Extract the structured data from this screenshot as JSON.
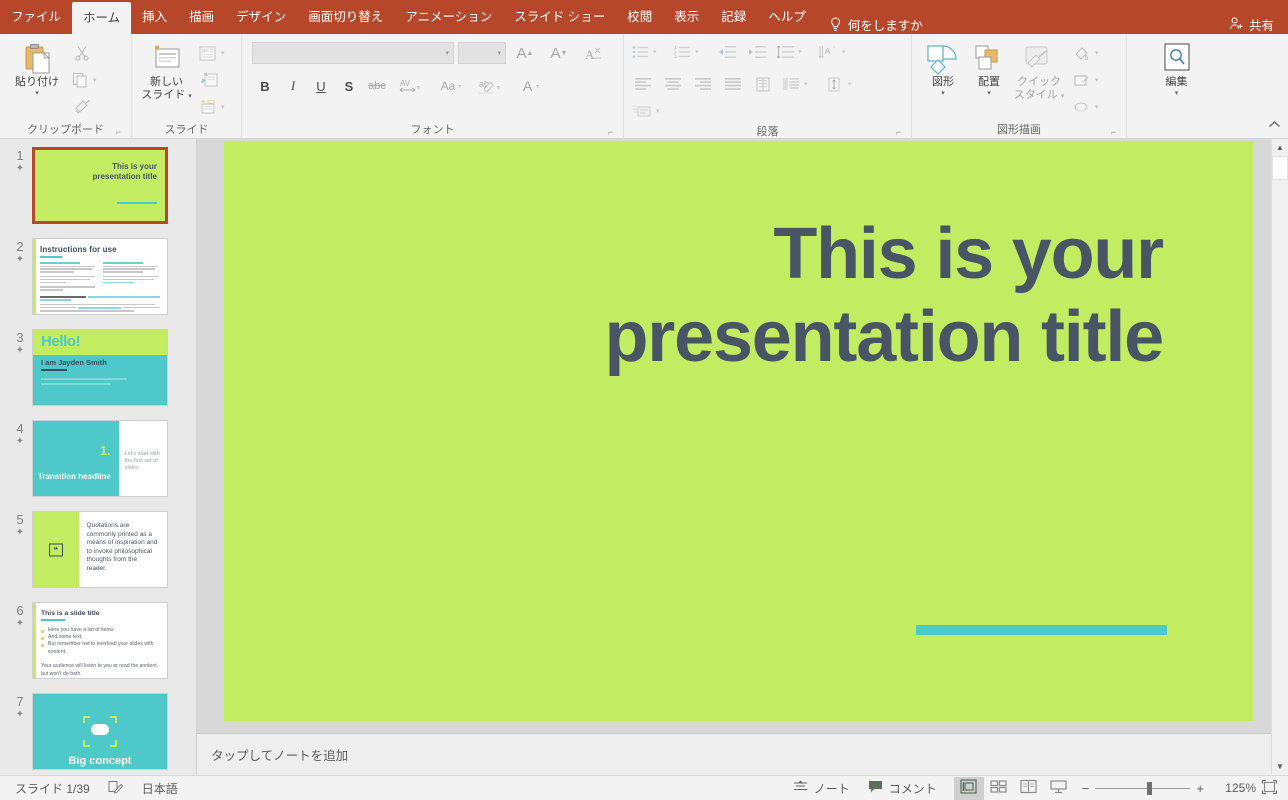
{
  "app": {
    "accent_color": "#b7472a",
    "ribbon_bg": "#f3f3f3"
  },
  "tabs": [
    {
      "id": "file",
      "label": "ファイル",
      "active": false
    },
    {
      "id": "home",
      "label": "ホーム",
      "active": true
    },
    {
      "id": "insert",
      "label": "挿入",
      "active": false
    },
    {
      "id": "draw",
      "label": "描画",
      "active": false
    },
    {
      "id": "design",
      "label": "デザイン",
      "active": false
    },
    {
      "id": "transitions",
      "label": "画面切り替え",
      "active": false
    },
    {
      "id": "animations",
      "label": "アニメーション",
      "active": false
    },
    {
      "id": "slideshow",
      "label": "スライド ショー",
      "active": false
    },
    {
      "id": "review",
      "label": "校閲",
      "active": false
    },
    {
      "id": "view",
      "label": "表示",
      "active": false
    },
    {
      "id": "record",
      "label": "記録",
      "active": false
    },
    {
      "id": "help",
      "label": "ヘルプ",
      "active": false
    }
  ],
  "tellme": {
    "label": "何をしますか",
    "icon": "lightbulb-icon"
  },
  "share": {
    "label": "共有",
    "icon": "share-person-icon"
  },
  "ribbon": {
    "clipboard": {
      "group_label": "クリップボード",
      "paste_label": "貼り付け",
      "cut_label": "切り取り",
      "copy_label": "コピー",
      "format_painter_label": "書式のコピー/貼り付け"
    },
    "slides": {
      "group_label": "スライド",
      "new_slide_label": "新しい\nスライド",
      "new_slide_line1": "新しい",
      "new_slide_line2": "スライド",
      "layout_label": "レイアウト",
      "reset_label": "リセット",
      "section_label": "セクション"
    },
    "font": {
      "group_label": "フォント",
      "font_name_value": "",
      "font_size_value": "",
      "grow_font_label": "A",
      "shrink_font_label": "A",
      "clear_format_label": "すべての書式をクリア",
      "bold_label": "B",
      "italic_label": "I",
      "underline_label": "U",
      "shadow_label": "S",
      "strike_label": "abc",
      "spacing_label": "AV",
      "case_label": "Aa",
      "highlight_label": "ab",
      "color_label": "A"
    },
    "paragraph": {
      "group_label": "段落"
    },
    "drawing": {
      "group_label": "図形描画",
      "shapes_label": "図形",
      "arrange_label": "配置",
      "quickstyles_line1": "クイック",
      "quickstyles_line2": "スタイル"
    },
    "editing": {
      "group_label": "",
      "edit_label": "編集"
    },
    "collapse_icon": "chevron-up-icon"
  },
  "thumbnails": [
    {
      "number": "1",
      "type": "title",
      "selected": true,
      "title": "This is your presentation title"
    },
    {
      "number": "2",
      "type": "instructions",
      "selected": false,
      "title": "Instructions for use"
    },
    {
      "number": "3",
      "type": "hello",
      "selected": false,
      "heading": "Hello!",
      "subtitle": "I am Jayden Smith",
      "body": "I am here because I love to give presentations. You can find me at @username"
    },
    {
      "number": "4",
      "type": "transition",
      "selected": false,
      "number_label": "1.",
      "heading": "Transition headline",
      "body": "Let's start with the first set of slides"
    },
    {
      "number": "5",
      "type": "quote",
      "selected": false,
      "body": "Quotations are commonly printed as a means of inspiration and to invoke philosophical thoughts from the reader."
    },
    {
      "number": "6",
      "type": "list",
      "selected": false,
      "title": "This is a slide title",
      "items": [
        "Here you have a list of items",
        "And some text",
        "But remember not to overload your slides with content"
      ],
      "footer": "Your audience will listen to you or read the content, but won't do both."
    },
    {
      "number": "7",
      "type": "bigconcept",
      "selected": false,
      "heading": "Big concept"
    }
  ],
  "slide": {
    "background_color": "#c3ec63",
    "title_text": "This is your presentation title",
    "title_color": "#495464",
    "accent_color": "#4ec8c8"
  },
  "notes": {
    "placeholder": "タップしてノートを追加"
  },
  "status": {
    "slide_counter": "スライド 1/39",
    "accessibility_icon": "accessibility-check-icon",
    "language": "日本語",
    "notes_label": "ノート",
    "comments_label": "コメント",
    "views": [
      {
        "id": "normal",
        "icon": "normal-view-icon",
        "active": true
      },
      {
        "id": "slide-sorter",
        "icon": "slide-sorter-icon",
        "active": false
      },
      {
        "id": "reading",
        "icon": "reading-view-icon",
        "active": false
      },
      {
        "id": "slideshow",
        "icon": "slideshow-view-icon",
        "active": false
      }
    ],
    "zoom_out_label": "−",
    "zoom_in_label": "+",
    "zoom_level": "125%",
    "fit_icon": "fit-to-window-icon"
  }
}
